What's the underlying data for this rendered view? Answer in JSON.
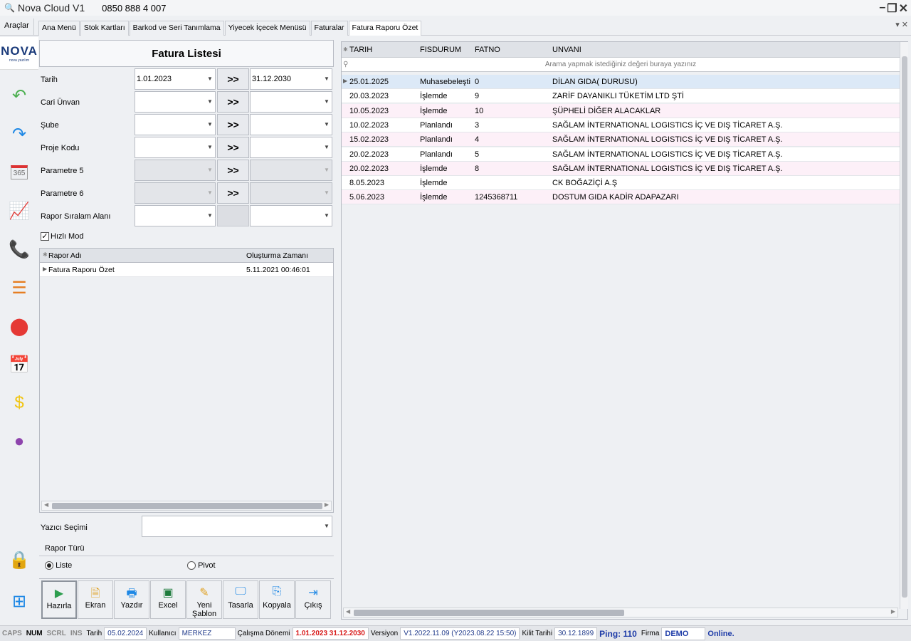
{
  "app": {
    "title": "Nova Cloud V1",
    "phone": "0850 888 4 007"
  },
  "tools_label": "Araçlar",
  "tabs": [
    "Ana Menü",
    "Stok Kartları",
    "Barkod ve Seri Tanımlama",
    "Yiyecek İçecek Menüsü",
    "Faturalar",
    "Fatura Raporu Özet"
  ],
  "logo": {
    "brand": "NOVA",
    "tagline": "nova yazılım"
  },
  "sidebar_icons": [
    "undo-icon",
    "redo-icon",
    "calendar-365-icon",
    "chart-icon",
    "phone-24-icon",
    "list-icon",
    "cloud-icon",
    "schedule-icon",
    "currency-exchange-icon",
    "color-wheel-icon",
    "lock-icon",
    "windows-icon"
  ],
  "panel_title": "Fatura Listesi",
  "filters": {
    "tarih": {
      "label": "Tarih",
      "from": "1.01.2023",
      "to": "31.12.2030"
    },
    "cari": {
      "label": "Cari Ünvan"
    },
    "sube": {
      "label": "Şube"
    },
    "proje": {
      "label": "Proje Kodu"
    },
    "param5": {
      "label": "Parametre 5"
    },
    "param6": {
      "label": "Parametre 6"
    },
    "sirala": {
      "label": "Rapor Sıralam Alanı"
    },
    "arrow": ">>"
  },
  "hizli_mod": "Hızlı Mod",
  "report_grid": {
    "columns": [
      "Rapor Adı",
      "Oluşturma Zamanı"
    ],
    "rows": [
      {
        "name": "Fatura Raporu Özet",
        "time": "5.11.2021 00:46:01"
      }
    ]
  },
  "yazici_label": "Yazıcı Seçimi",
  "rapor_turu": {
    "label": "Rapor Türü",
    "liste": "Liste",
    "pivot": "Pivot"
  },
  "buttons": [
    "Hazırla",
    "Ekran",
    "Yazdır",
    "Excel",
    "Yeni Şablon",
    "Tasarla",
    "Kopyala",
    "Çıkış"
  ],
  "main_grid": {
    "columns": [
      "TARIH",
      "FISDURUM",
      "FATNO",
      "UNVANI"
    ],
    "search_placeholder": "Arama yapmak istediğiniz değeri buraya yazınız",
    "rows": [
      [
        "25.01.2025",
        "Muhasebeleşti",
        "0",
        "DİLAN GIDA( DURUSU)"
      ],
      [
        "20.03.2023",
        "İşlemde",
        "9",
        "ZARİF DAYANIKLI TÜKETİM LTD ŞTİ"
      ],
      [
        "10.05.2023",
        "İşlemde",
        "10",
        "ŞÜPHELİ DİĞER ALACAKLAR"
      ],
      [
        "10.02.2023",
        "Planlandı",
        "3",
        "SAĞLAM İNTERNATIONAL LOGISTICS İÇ VE DIŞ TİCARET A.Ş."
      ],
      [
        "15.02.2023",
        "Planlandı",
        "4",
        "SAĞLAM İNTERNATIONAL LOGISTICS İÇ VE DIŞ TİCARET A.Ş."
      ],
      [
        "20.02.2023",
        "Planlandı",
        "5",
        "SAĞLAM İNTERNATIONAL LOGISTICS İÇ VE DIŞ TİCARET A.Ş."
      ],
      [
        "20.02.2023",
        "İşlemde",
        "8",
        "SAĞLAM İNTERNATIONAL LOGISTICS İÇ VE DIŞ TİCARET A.Ş."
      ],
      [
        "8.05.2023",
        "İşlemde",
        "",
        "CK BOĞAZİÇİ A.Ş"
      ],
      [
        "5.06.2023",
        "İşlemde",
        "1245368711",
        "DOSTUM GIDA KADİR ADAPAZARI"
      ]
    ]
  },
  "status": {
    "caps": "CAPS",
    "num": "NUM",
    "scrl": "SCRL",
    "ins": "INS",
    "tarih_label": "Tarih",
    "tarih": "05.02.2024",
    "kullanici_label": "Kullanıcı",
    "kullanici": "MERKEZ",
    "donem_label": "Çalışma Dönemi",
    "donem": "1.01.2023  31.12.2030",
    "versiyon_label": "Versiyon",
    "versiyon": "V1.2022.11.09 (Y2023.08.22 15:50)",
    "kilit_label": "Kilit Tarihi",
    "kilit": "30.12.1899",
    "ping": "Ping: 110",
    "firma_label": "Firma",
    "firma": "DEMO",
    "online": "Online."
  }
}
